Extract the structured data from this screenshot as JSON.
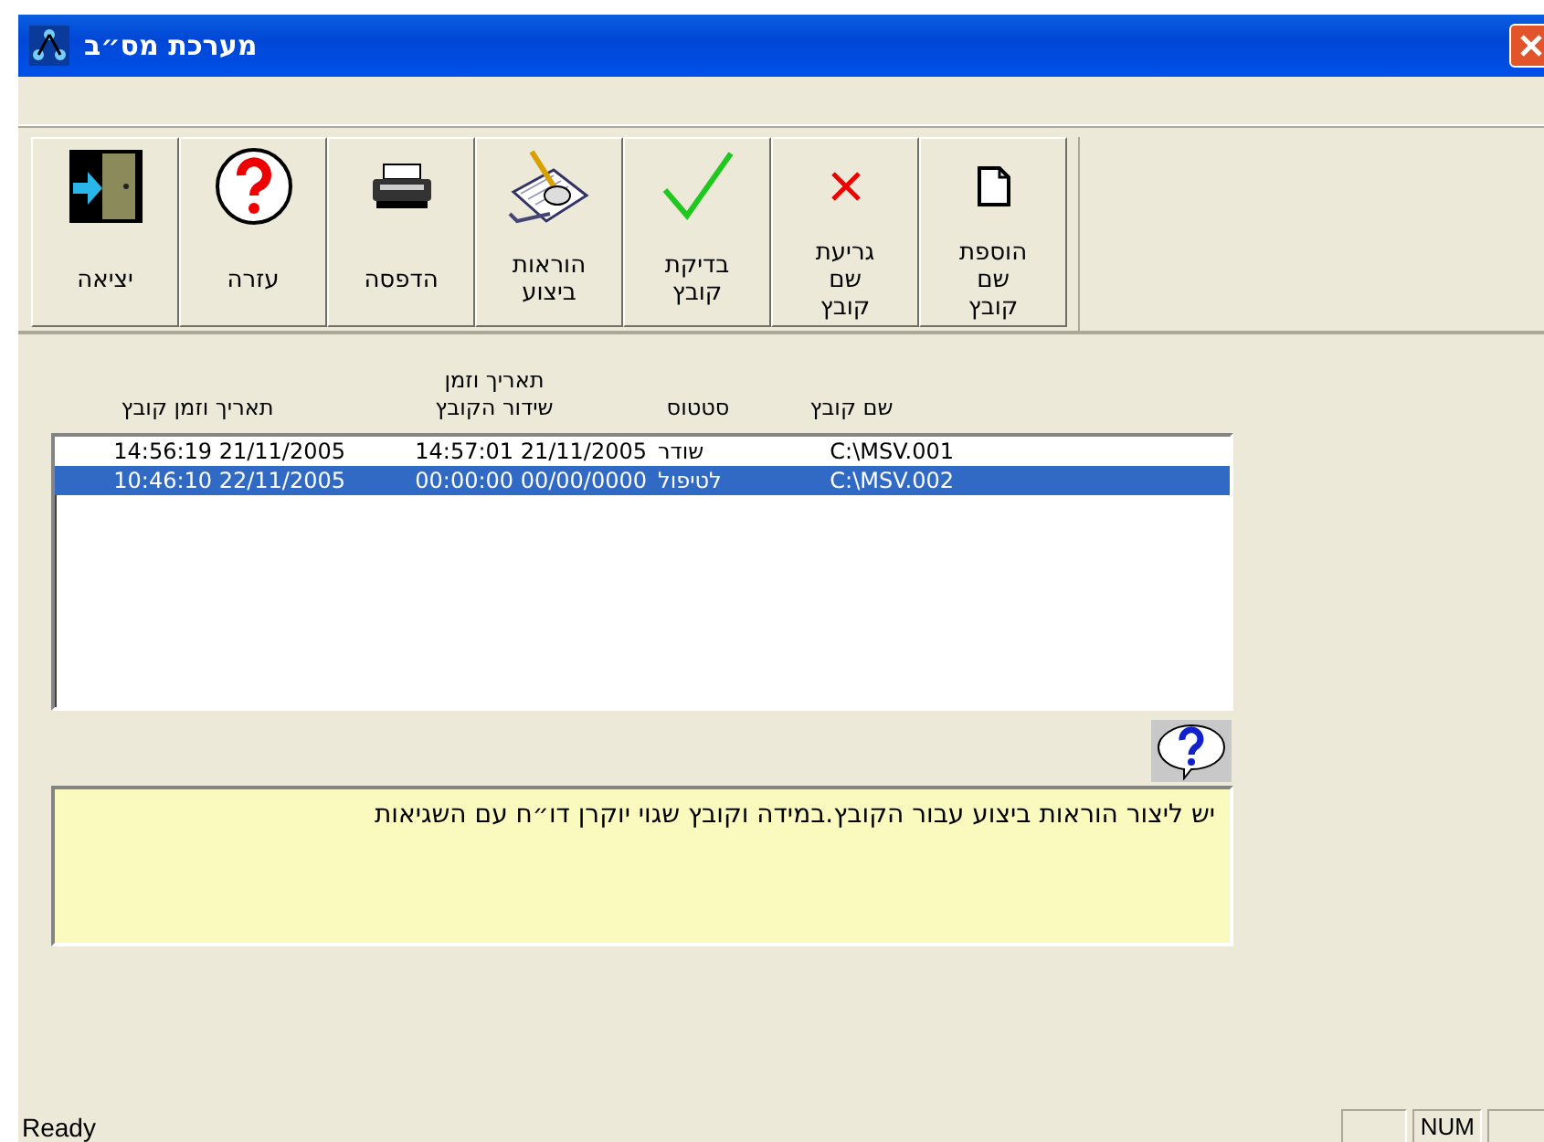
{
  "window": {
    "title": "מערכת מס״ב"
  },
  "toolbar": [
    {
      "kind": "add",
      "lines": [
        "הוספת",
        "שם",
        "קובץ"
      ]
    },
    {
      "kind": "remove",
      "lines": [
        "גריעת",
        "שם",
        "קובץ"
      ]
    },
    {
      "kind": "check",
      "lines": [
        "בדיקת",
        "קובץ"
      ]
    },
    {
      "kind": "instructions",
      "lines": [
        "הוראות",
        "ביצוע"
      ]
    },
    {
      "kind": "print",
      "lines": [
        "הדפסה"
      ]
    },
    {
      "kind": "help",
      "lines": [
        "עזרה"
      ]
    },
    {
      "kind": "exit",
      "lines": [
        "יציאה"
      ]
    }
  ],
  "table": {
    "columns": [
      "שם קובץ",
      "סטטוס",
      "תאריך וזמן שידור הקובץ",
      "תאריך וזמן קובץ"
    ],
    "rows": [
      {
        "selected": false,
        "cells": [
          "C:\\MSV.001",
          "שודר",
          "14:57:01 21/11/2005",
          "14:56:19 21/11/2005"
        ]
      },
      {
        "selected": true,
        "cells": [
          "C:\\MSV.002",
          "לטיפול",
          "00:00:00 00/00/0000",
          "10:46:10 22/11/2005"
        ]
      }
    ]
  },
  "message": "יש ליצור הוראות ביצוע עבור הקובץ.במידה וקובץ שגוי יוקרן דו״ח עם השגיאות",
  "status_bar": {
    "text": "Ready",
    "indicator": "NUM"
  }
}
